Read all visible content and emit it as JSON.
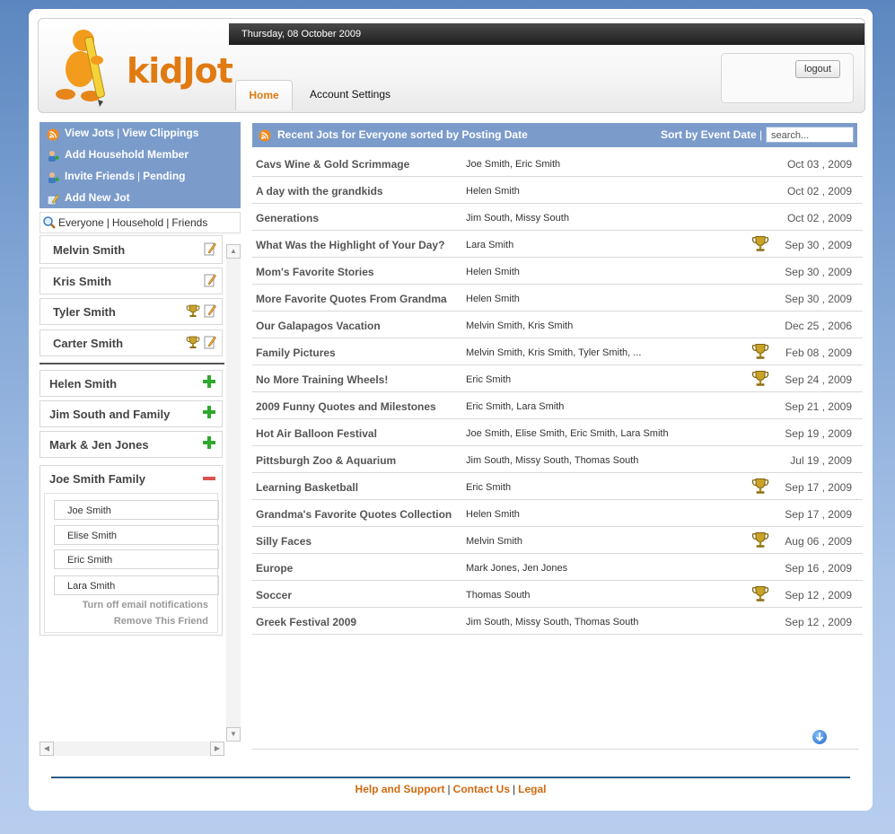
{
  "header": {
    "logo_text": "kidJot",
    "date": "Thursday, 08 October 2009",
    "tabs": [
      "Home",
      "Account Settings"
    ],
    "logout_label": "logout"
  },
  "sidebar": {
    "menu": [
      {
        "a": "View Jots",
        "b": "View Clippings",
        "icon": "rss-icon"
      },
      {
        "a": "Add Household Member",
        "b": "",
        "icon": "add-person-icon"
      },
      {
        "a": "Invite Friends",
        "b": "Pending",
        "icon": "add-person-icon"
      },
      {
        "a": "Add New Jot",
        "b": "",
        "icon": "pencil-icon"
      }
    ],
    "filter": {
      "everyone": "Everyone",
      "household": "Household",
      "friends": "Friends"
    },
    "household": [
      "Melvin Smith",
      "Kris Smith",
      "Tyler Smith",
      "Carter Smith"
    ],
    "friends": [
      "Helen Smith",
      "Jim South and Family",
      "Mark & Jen Jones"
    ],
    "expanded_family": {
      "name": "Joe Smith Family",
      "members": [
        "Joe Smith",
        "Elise Smith",
        "Eric Smith",
        "Lara Smith"
      ],
      "email_toggle": "Turn off email notifications",
      "remove": "Remove This Friend"
    }
  },
  "content": {
    "title": "Recent Jots for Everyone sorted by Posting Date",
    "sort_label": "Sort by Event Date",
    "search_placeholder": "search...",
    "rows": [
      {
        "title": "Cavs Wine & Gold Scrimmage",
        "people": "Joe Smith, Eric Smith",
        "date": "Oct 03 , 2009",
        "trophy": false
      },
      {
        "title": "A day with the grandkids",
        "people": "Helen Smith",
        "date": "Oct 02 , 2009",
        "trophy": false
      },
      {
        "title": "Generations",
        "people": "Jim South, Missy South",
        "date": "Oct 02 , 2009",
        "trophy": false
      },
      {
        "title": "What Was the Highlight of Your Day?",
        "people": "Lara Smith",
        "date": "Sep 30 , 2009",
        "trophy": true
      },
      {
        "title": "Mom's Favorite Stories",
        "people": "Helen Smith",
        "date": "Sep 30 , 2009",
        "trophy": false
      },
      {
        "title": "More Favorite Quotes From Grandma",
        "people": "Helen Smith",
        "date": "Sep 30 , 2009",
        "trophy": false
      },
      {
        "title": "Our Galapagos Vacation",
        "people": "Melvin Smith, Kris Smith",
        "date": "Dec 25 , 2006",
        "trophy": false
      },
      {
        "title": "Family Pictures",
        "people": "Melvin Smith, Kris Smith, Tyler Smith, ...",
        "date": "Feb 08 , 2009",
        "trophy": true
      },
      {
        "title": "No More Training Wheels!",
        "people": "Eric Smith",
        "date": "Sep 24 , 2009",
        "trophy": true
      },
      {
        "title": "2009 Funny Quotes and Milestones",
        "people": "Eric Smith, Lara Smith",
        "date": "Sep 21 , 2009",
        "trophy": false
      },
      {
        "title": "Hot Air Balloon Festival",
        "people": "Joe Smith, Elise Smith, Eric Smith, Lara Smith",
        "date": "Sep 19 , 2009",
        "trophy": false
      },
      {
        "title": "Pittsburgh Zoo & Aquarium",
        "people": "Jim South, Missy South, Thomas South",
        "date": "Jul 19 , 2009",
        "trophy": false
      },
      {
        "title": "Learning Basketball",
        "people": "Eric Smith",
        "date": "Sep 17 , 2009",
        "trophy": true
      },
      {
        "title": "Grandma's Favorite Quotes Collection",
        "people": "Helen Smith",
        "date": "Sep 17 , 2009",
        "trophy": false
      },
      {
        "title": "Silly Faces",
        "people": "Melvin Smith",
        "date": "Aug 06 , 2009",
        "trophy": true
      },
      {
        "title": "Europe",
        "people": "Mark Jones, Jen Jones",
        "date": "Sep 16 , 2009",
        "trophy": false
      },
      {
        "title": "Soccer",
        "people": "Thomas South",
        "date": "Sep 12 , 2009",
        "trophy": true
      },
      {
        "title": "Greek Festival 2009",
        "people": "Jim South, Missy South, Thomas South",
        "date": "Sep 12 , 2009",
        "trophy": false
      }
    ]
  },
  "footer": {
    "links": [
      "Help and Support",
      "Contact Us",
      "Legal"
    ]
  },
  "colors": {
    "accent_orange": "#e07b12",
    "header_blue": "#7b9ccb",
    "footer_line": "#2b5c86"
  }
}
